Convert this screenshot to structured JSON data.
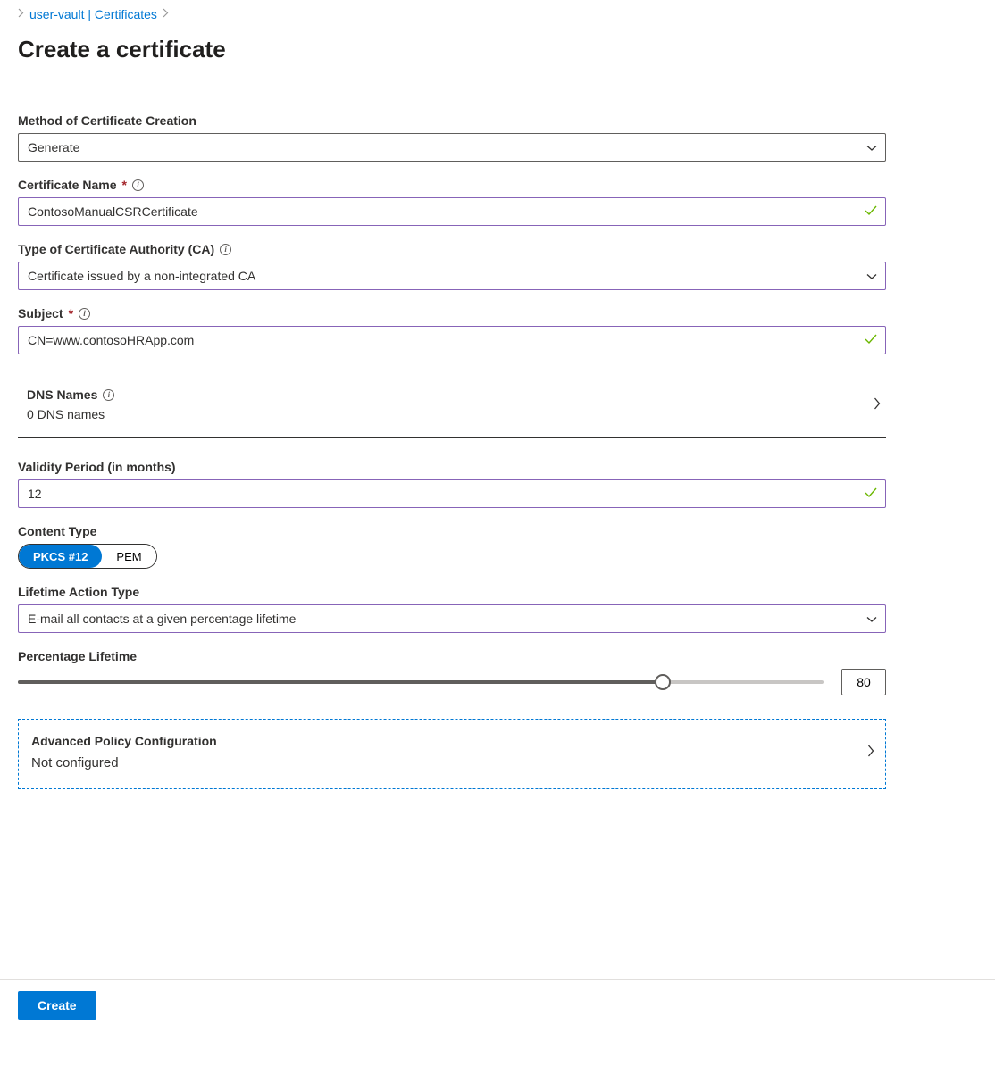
{
  "breadcrumb": {
    "item1": "user-vault | Certificates"
  },
  "page_title": "Create a certificate",
  "fields": {
    "method": {
      "label": "Method of Certificate Creation",
      "value": "Generate"
    },
    "cert_name": {
      "label": "Certificate Name",
      "value": "ContosoManualCSRCertificate"
    },
    "ca_type": {
      "label": "Type of Certificate Authority (CA)",
      "value": "Certificate issued by a non-integrated CA"
    },
    "subject": {
      "label": "Subject",
      "value": "CN=www.contosoHRApp.com"
    },
    "dns_names": {
      "label": "DNS Names",
      "value": "0 DNS names"
    },
    "validity": {
      "label": "Validity Period (in months)",
      "value": "12"
    },
    "content_type": {
      "label": "Content Type",
      "option_pkcs": "PKCS #12",
      "option_pem": "PEM",
      "selected": "PKCS #12"
    },
    "lifetime_action": {
      "label": "Lifetime Action Type",
      "value": "E-mail all contacts at a given percentage lifetime"
    },
    "percentage": {
      "label": "Percentage Lifetime",
      "value": "80"
    },
    "advanced": {
      "label": "Advanced Policy Configuration",
      "value": "Not configured"
    }
  },
  "footer": {
    "create_label": "Create"
  }
}
